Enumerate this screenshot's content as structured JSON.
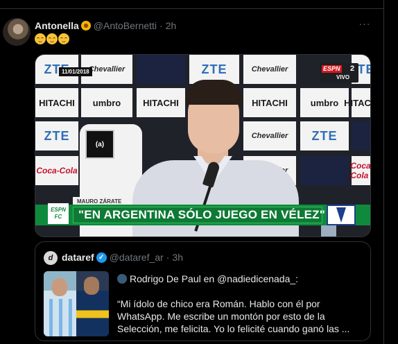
{
  "tweet": {
    "author_name": "Antonella",
    "author_flower": "sunflower-emoji",
    "handle": "@AntoBernetti",
    "separator": "·",
    "time": "2h",
    "more_label": "···",
    "text_emojis": [
      "relieved-face",
      "relieved-face",
      "relieved-face"
    ]
  },
  "media": {
    "date_badge": "11/01/2018",
    "espn_logo": "ESPN",
    "espn_channel": "2",
    "espn_live": "VIVO",
    "sponsor_logos": [
      "ZTE",
      "Chevallier",
      "HITACHI",
      "umbro",
      "Coca-Cola"
    ],
    "chair_logo": "(a)",
    "lower_third_name": "MAURO ZÁRATE",
    "lower_third_quote": "\"EN ARGENTINA SÓLO JUEGO EN VÉLEZ\"",
    "espn_fc_label": "ESPN FC"
  },
  "quote": {
    "avatar_letter": "d",
    "name": "dataref",
    "verified": "✓",
    "handle": "@dataref_ar",
    "separator": "·",
    "time": "3h",
    "line1": "Rodrigo De Paul en @nadiedicenada_:",
    "body": "“Mi ídolo de chico era Román. Hablo con él por WhatsApp. Me escribe un montón por esto de la Selección, me felicita. Yo lo felicité cuando ganó las ..."
  },
  "colors": {
    "background": "#000000",
    "text": "#e7e9ea",
    "muted": "#71767b",
    "border": "#2f3336",
    "verified": "#1d9bf0",
    "lower_third_green": "#0f8a3d"
  }
}
